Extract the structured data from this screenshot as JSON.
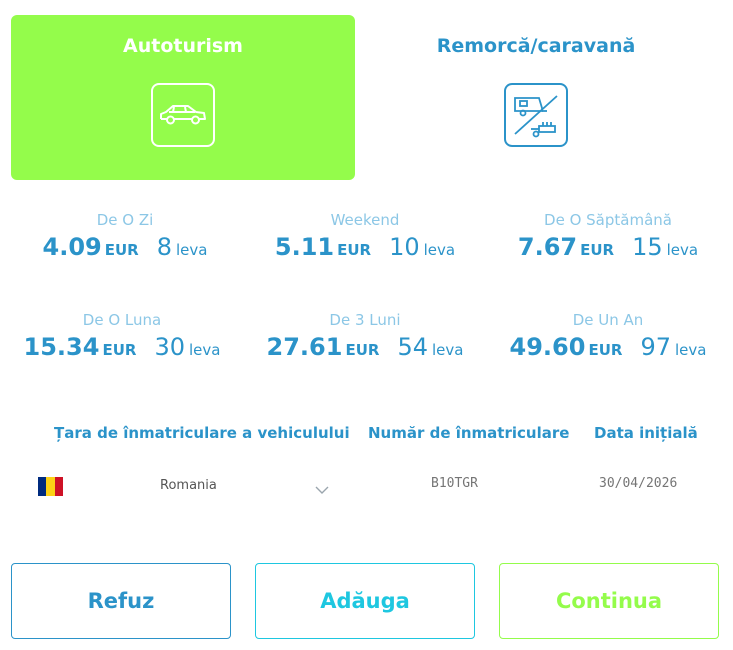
{
  "vehicle_tabs": [
    {
      "label": "Autoturism",
      "icon": "car-icon",
      "selected": true
    },
    {
      "label": "Remorcă/caravană",
      "icon": "trailer-caravan-icon",
      "selected": false
    }
  ],
  "prices": [
    {
      "label": "De O Zi",
      "eur": "4.09",
      "eur_unit": "EUR",
      "leva": "8",
      "leva_unit": "leva"
    },
    {
      "label": "Weekend",
      "eur": "5.11",
      "eur_unit": "EUR",
      "leva": "10",
      "leva_unit": "leva"
    },
    {
      "label": "De O Săptămână",
      "eur": "7.67",
      "eur_unit": "EUR",
      "leva": "15",
      "leva_unit": "leva"
    },
    {
      "label": "De O Luna",
      "eur": "15.34",
      "eur_unit": "EUR",
      "leva": "30",
      "leva_unit": "leva"
    },
    {
      "label": "De 3 Luni",
      "eur": "27.61",
      "eur_unit": "EUR",
      "leva": "54",
      "leva_unit": "leva"
    },
    {
      "label": "De Un An",
      "eur": "49.60",
      "eur_unit": "EUR",
      "leva": "97",
      "leva_unit": "leva"
    }
  ],
  "form": {
    "country_header": "Țara de înmatriculare a vehiculului",
    "plate_header": "Număr de înmatriculare",
    "date_header": "Data inițială",
    "country_value": "Romania",
    "plate_placeholder": "B10TGR",
    "date_placeholder": "30/04/2026"
  },
  "flag_colors": [
    "#002b7f",
    "#fcd116",
    "#ce1126"
  ],
  "buttons": {
    "refuz": "Refuz",
    "adauga": "Adăuga",
    "continua": "Continua"
  },
  "colors": {
    "accent_green": "#94fc4b",
    "primary_blue": "#2b93c9",
    "cyan": "#1ec7e0"
  }
}
